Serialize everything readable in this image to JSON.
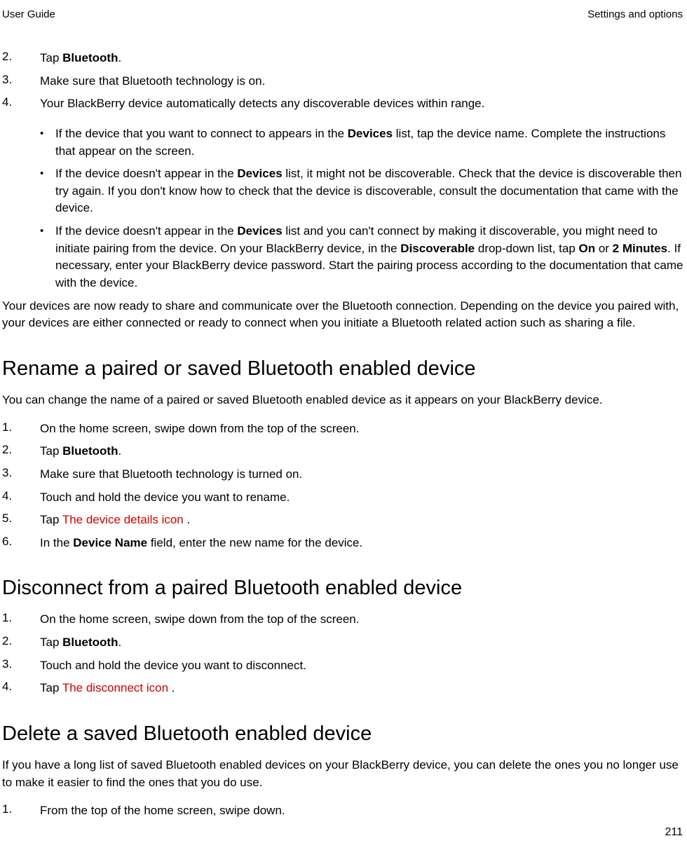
{
  "header": {
    "left": "User Guide",
    "right": "Settings and options"
  },
  "section1": {
    "steps": [
      {
        "num": "2.",
        "prefix": "Tap ",
        "bold": "Bluetooth",
        "suffix": "."
      },
      {
        "num": "3.",
        "text": "Make sure that Bluetooth technology is on."
      },
      {
        "num": "4.",
        "text": "Your BlackBerry device automatically detects any discoverable devices within range."
      }
    ],
    "bullets": [
      {
        "parts": [
          {
            "t": "If the device that you want to connect to appears in the "
          },
          {
            "t": "Devices",
            "b": true
          },
          {
            "t": " list, tap the device name. Complete the instructions that appear on the screen."
          }
        ]
      },
      {
        "parts": [
          {
            "t": "If the device doesn't appear in the "
          },
          {
            "t": "Devices",
            "b": true
          },
          {
            "t": " list, it might not be discoverable. Check that the device is discoverable then try again. If you don't know how to check that the device is discoverable, consult the documentation that came with the device."
          }
        ]
      },
      {
        "parts": [
          {
            "t": "If the device doesn't appear in the "
          },
          {
            "t": "Devices",
            "b": true
          },
          {
            "t": " list and you can't connect by making it discoverable, you might need to initiate pairing from the device. On your BlackBerry device, in the "
          },
          {
            "t": "Discoverable",
            "b": true
          },
          {
            "t": " drop-down list, tap "
          },
          {
            "t": "On",
            "b": true
          },
          {
            "t": " or "
          },
          {
            "t": "2 Minutes",
            "b": true
          },
          {
            "t": ". If necessary, enter your BlackBerry device password. Start the pairing process according to the documentation that came with the device."
          }
        ]
      }
    ],
    "closing": "Your devices are now ready to share and communicate over the Bluetooth connection. Depending on the device you paired with, your devices are either connected or ready to connect when you initiate a Bluetooth related action such as sharing a file."
  },
  "section2": {
    "heading": "Rename a paired or saved Bluetooth enabled device",
    "intro": "You can change the name of a paired or saved Bluetooth enabled device as it appears on your BlackBerry device.",
    "steps": [
      {
        "num": "1.",
        "text": "On the home screen, swipe down from the top of the screen."
      },
      {
        "num": "2.",
        "prefix": "Tap ",
        "bold": "Bluetooth",
        "suffix": "."
      },
      {
        "num": "3.",
        "text": "Make sure that Bluetooth technology is turned on."
      },
      {
        "num": "4.",
        "text": "Touch and hold the device you want to rename."
      },
      {
        "num": "5.",
        "prefix": "Tap  ",
        "red": "The device details icon",
        "suffix": " ."
      },
      {
        "num": "6.",
        "prefix": "In the ",
        "bold": "Device Name",
        "suffix": " field, enter the new name for the device."
      }
    ]
  },
  "section3": {
    "heading": "Disconnect from a paired Bluetooth enabled device",
    "steps": [
      {
        "num": "1.",
        "text": "On the home screen, swipe down from the top of the screen."
      },
      {
        "num": "2.",
        "prefix": "Tap ",
        "bold": "Bluetooth",
        "suffix": "."
      },
      {
        "num": "3.",
        "text": "Touch and hold the device you want to disconnect."
      },
      {
        "num": "4.",
        "prefix": "Tap  ",
        "red": "The disconnect icon",
        "suffix": " ."
      }
    ]
  },
  "section4": {
    "heading": "Delete a saved Bluetooth enabled device",
    "intro": "If you have a long list of saved Bluetooth enabled devices on your BlackBerry device, you can delete the ones you no longer use to make it easier to find the ones that you do use.",
    "steps": [
      {
        "num": "1.",
        "text": "From the top of the home screen, swipe down."
      }
    ]
  },
  "pageNumber": "211"
}
